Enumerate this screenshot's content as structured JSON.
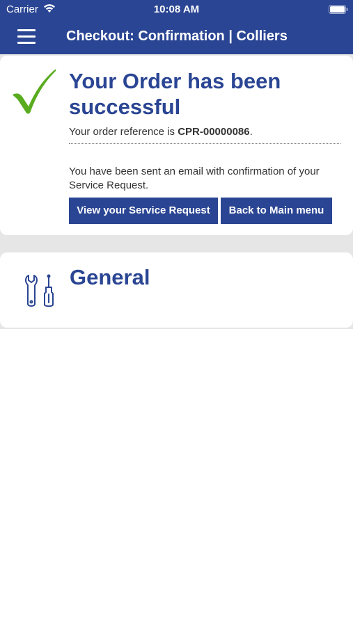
{
  "status_bar": {
    "carrier": "Carrier",
    "time": "10:08 AM"
  },
  "nav": {
    "title": "Checkout: Confirmation | Colliers"
  },
  "confirmation": {
    "headline": "Your Order has been successful",
    "reference_prefix": "Your order reference is ",
    "reference_number": "CPR-00000086",
    "reference_suffix": ".",
    "email_message": "You have been sent an email with confirmation of your Service Request.",
    "view_button_label": "View your Service Request",
    "back_button_label": "Back to Main menu"
  },
  "general_section": {
    "title": "General"
  },
  "colors": {
    "brand_blue": "#2a4593",
    "check_green": "#5aac1f",
    "background_gray": "#e6e6e6"
  },
  "icons": {
    "check": "checkmark-icon",
    "tools": "tools-icon",
    "menu": "hamburger-menu-icon"
  }
}
